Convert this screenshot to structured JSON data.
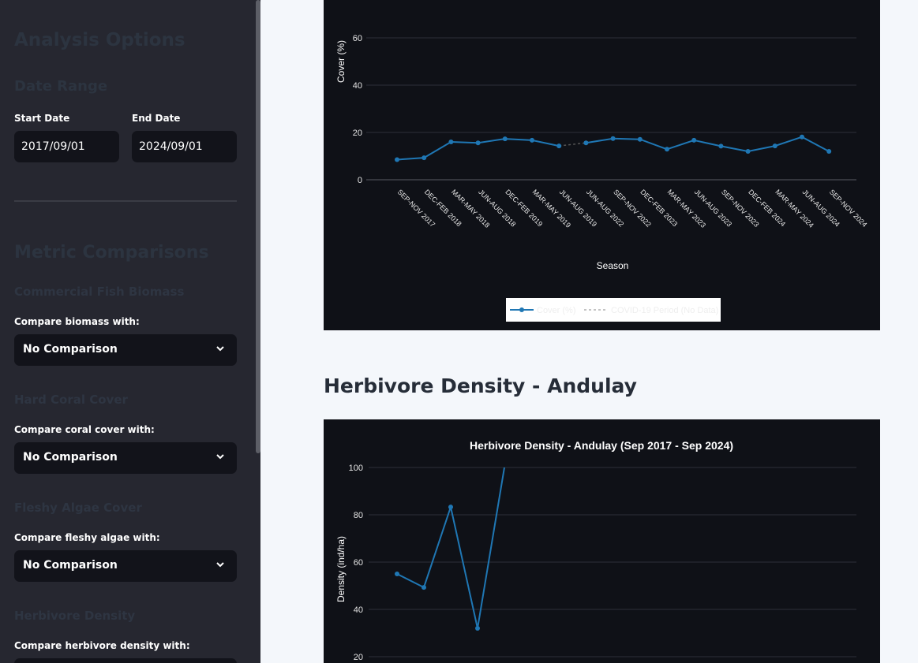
{
  "sidebar": {
    "title": "Analysis Options",
    "date_range": {
      "heading": "Date Range",
      "start_label": "Start Date",
      "start_value": "2017/09/01",
      "end_label": "End Date",
      "end_value": "2024/09/01"
    },
    "metric_comparisons": {
      "heading": "Metric Comparisons",
      "groups": [
        {
          "heading": "Commercial Fish Biomass",
          "label": "Compare biomass with:",
          "value": "No Comparison"
        },
        {
          "heading": "Hard Coral Cover",
          "label": "Compare coral cover with:",
          "value": "No Comparison"
        },
        {
          "heading": "Fleshy Algae Cover",
          "label": "Compare fleshy algae with:",
          "value": "No Comparison"
        },
        {
          "heading": "Herbivore Density",
          "label": "Compare herbivore density with:"
        }
      ]
    }
  },
  "main": {
    "herbivore_section_title": "Herbivore Density - Andulay"
  },
  "colors": {
    "series": "#1f77b4",
    "chart_bg": "#0f1117",
    "grid": "#2e3038",
    "sidebar_bg": "#262730"
  },
  "chart_data": [
    {
      "type": "line",
      "title": "",
      "xlabel": "Season",
      "ylabel": "Cover (%)",
      "ylim": [
        0,
        70
      ],
      "yticks": [
        0,
        20,
        40,
        60
      ],
      "categories": [
        "SEP-NOV 2017",
        "DEC-FEB 2018",
        "MAR-MAY 2018",
        "JUN-AUG 2018",
        "DEC-FEB 2019",
        "MAR-MAY 2019",
        "JUN-AUG 2019",
        "JUN-AUG 2022",
        "SEP-NOV 2022",
        "DEC-FEB 2023",
        "MAR-MAY 2023",
        "JUN-AUG 2023",
        "SEP-NOV 2023",
        "DEC-FEB 2024",
        "MAR-MAY 2024",
        "JUN-AUG 2024",
        "SEP-NOV 2024"
      ],
      "series": [
        {
          "name": "Cover (%)",
          "values": [
            8.5,
            9.3,
            16.0,
            15.6,
            17.3,
            16.7,
            14.3,
            15.6,
            17.4,
            17.1,
            12.9,
            16.7,
            14.2,
            12.0,
            14.3,
            18.1,
            12.0
          ]
        }
      ],
      "covid_gap": {
        "name": "COVID-19 Period (No Data)",
        "from_index": 6,
        "to_index": 7
      },
      "legend": [
        "Cover (%)",
        "COVID-19 Period (No Data)"
      ],
      "legend_position": "bottom-center",
      "grid": true
    },
    {
      "type": "line",
      "title": "Herbivore Density - Andulay (Sep 2017 - Sep 2024)",
      "xlabel": "",
      "ylabel": "Density (ind/ha)",
      "ylim": [
        20,
        100
      ],
      "yticks": [
        20,
        40,
        60,
        80,
        100
      ],
      "series": [
        {
          "name": "Density",
          "values": [
            55,
            49.3,
            83.3,
            32,
            100
          ]
        }
      ],
      "grid": true
    }
  ]
}
